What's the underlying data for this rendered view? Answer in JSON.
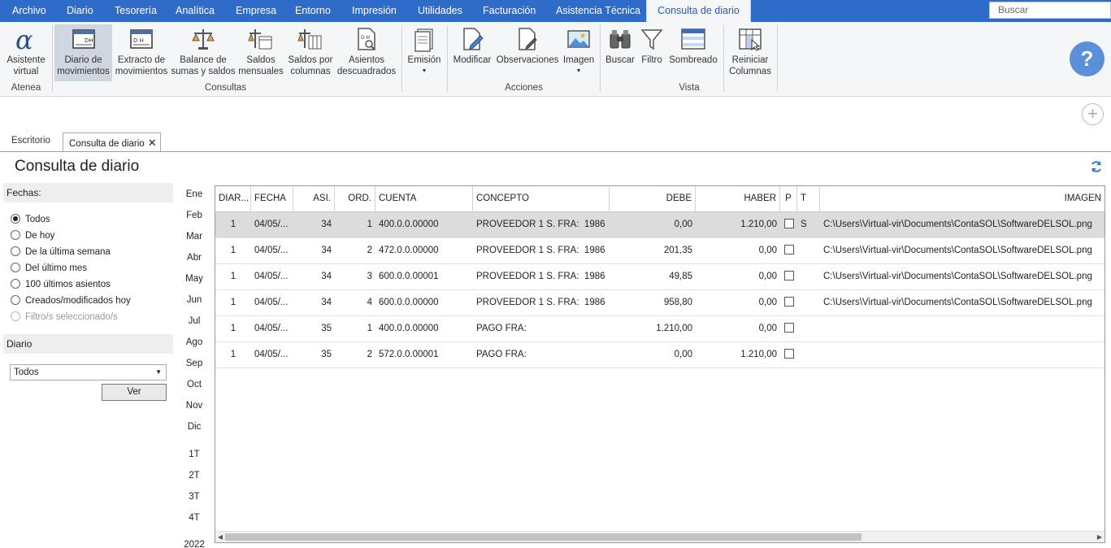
{
  "menu": {
    "items": [
      "Archivo",
      "Diario",
      "Tesorería",
      "Analítica",
      "Empresa",
      "Entorno",
      "Impresión",
      "Utilidades",
      "Facturación",
      "Asistencia Técnica"
    ],
    "active": "Consulta de diario",
    "search_placeholder": "Buscar"
  },
  "ribbon": {
    "atenea": {
      "button": [
        "Asistente",
        "virtual"
      ],
      "label": "Atenea"
    },
    "consultas": {
      "label": "Consultas",
      "buttons": [
        [
          "Diario de",
          "movimientos"
        ],
        [
          "Extracto de",
          "movimientos"
        ],
        [
          "Balance de",
          "sumas y saldos"
        ],
        [
          "Saldos",
          "mensuales"
        ],
        [
          "Saldos por",
          "columnas"
        ],
        [
          "Asientos",
          "descuadrados"
        ]
      ]
    },
    "emision": "Emisión",
    "acciones": {
      "label": "Acciones",
      "buttons": [
        "Modificar",
        "Observaciones",
        "Imagen"
      ]
    },
    "vista": {
      "label": "Vista",
      "buttons": [
        "Buscar",
        "Filtro",
        "Sombreado"
      ]
    },
    "reiniciar": [
      "Reiniciar",
      "Columnas"
    ]
  },
  "tabs": {
    "escritorio": "Escritorio",
    "active": "Consulta de diario"
  },
  "page": {
    "title": "Consulta de diario"
  },
  "filters": {
    "fechas_label": "Fechas:",
    "options": [
      "Todos",
      "De hoy",
      "De la última semana",
      "Del último mes",
      "100 últimos asientos",
      "Creados/modificados hoy",
      "Filtro/s seleccionado/s"
    ],
    "selected": "Todos",
    "diario_label": "Diario",
    "diario_value": "Todos",
    "ver_button": "Ver"
  },
  "months": [
    "Ene",
    "Feb",
    "Mar",
    "Abr",
    "May",
    "Jun",
    "Jul",
    "Ago",
    "Sep",
    "Oct",
    "Nov",
    "Dic"
  ],
  "quarters": [
    "1T",
    "2T",
    "3T",
    "4T"
  ],
  "year": "2022",
  "table": {
    "columns": [
      "DIAR...",
      "FECHA",
      "ASI.",
      "ORD.",
      "CUENTA",
      "CONCEPTO",
      "DEBE",
      "HABER",
      "P",
      "T",
      "IMAGEN"
    ],
    "rows": [
      {
        "diario": "1",
        "fecha": "04/05/...",
        "asi": "34",
        "ord": "1",
        "cuenta": "400.0.0.00000",
        "concepto": "PROVEEDOR 1 S. FRA:  1986",
        "debe": "0,00",
        "haber": "1.210,00",
        "t": "S",
        "imagen": "C:\\Users\\Virtual-vir\\Documents\\ContaSOL\\SoftwareDELSOL.png"
      },
      {
        "diario": "1",
        "fecha": "04/05/...",
        "asi": "34",
        "ord": "2",
        "cuenta": "472.0.0.00000",
        "concepto": "PROVEEDOR 1 S. FRA:  1986",
        "debe": "201,35",
        "haber": "0,00",
        "t": "",
        "imagen": "C:\\Users\\Virtual-vir\\Documents\\ContaSOL\\SoftwareDELSOL.png"
      },
      {
        "diario": "1",
        "fecha": "04/05/...",
        "asi": "34",
        "ord": "3",
        "cuenta": "600.0.0.00001",
        "concepto": "PROVEEDOR 1 S. FRA:  1986",
        "debe": "49,85",
        "haber": "0,00",
        "t": "",
        "imagen": "C:\\Users\\Virtual-vir\\Documents\\ContaSOL\\SoftwareDELSOL.png"
      },
      {
        "diario": "1",
        "fecha": "04/05/...",
        "asi": "34",
        "ord": "4",
        "cuenta": "600.0.0.00000",
        "concepto": "PROVEEDOR 1 S. FRA:  1986",
        "debe": "958,80",
        "haber": "0,00",
        "t": "",
        "imagen": "C:\\Users\\Virtual-vir\\Documents\\ContaSOL\\SoftwareDELSOL.png"
      },
      {
        "diario": "1",
        "fecha": "04/05/...",
        "asi": "35",
        "ord": "1",
        "cuenta": "400.0.0.00000",
        "concepto": "PAGO FRA:",
        "debe": "1.210,00",
        "haber": "0,00",
        "t": "",
        "imagen": ""
      },
      {
        "diario": "1",
        "fecha": "04/05/...",
        "asi": "35",
        "ord": "2",
        "cuenta": "572.0.0.00001",
        "concepto": "PAGO FRA:",
        "debe": "0,00",
        "haber": "1.210,00",
        "t": "",
        "imagen": ""
      }
    ]
  },
  "colors": {
    "menubar": "#2f6bc9",
    "help": "#5b8fd9",
    "selected_row": "#dcdcdc"
  }
}
